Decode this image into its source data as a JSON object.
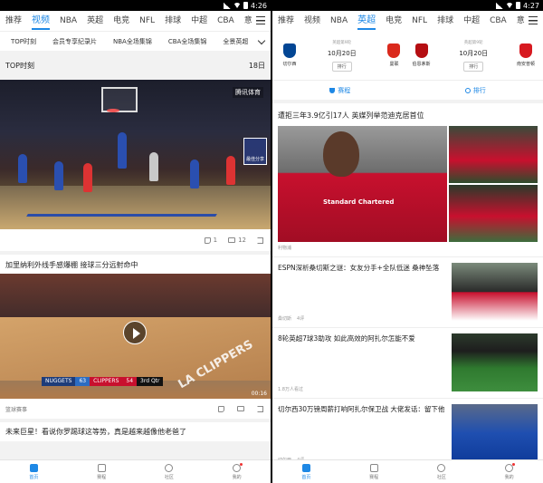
{
  "left": {
    "status": {
      "time": "4:26"
    },
    "tabs": [
      "推荐",
      "视频",
      "NBA",
      "英超",
      "电竞",
      "NFL",
      "排球",
      "中超",
      "CBA",
      "意"
    ],
    "active_tab": "视频",
    "chips": [
      "TOP时刻",
      "会员专享纪录片",
      "NBA全场集锦",
      "CBA全场集锦",
      "全景英超"
    ],
    "section": {
      "title": "TOP时刻",
      "date": "18日"
    },
    "video1": {
      "watermark": "腾讯体育",
      "mini_label": "最佳分享",
      "likes": "1",
      "comments": "12"
    },
    "video2": {
      "title": "加里纳利外线手感爆棚 接球三分远射命中",
      "court_logo": "LA CLIPPERS",
      "score": {
        "away": "NUGGETS",
        "away_score": "63",
        "home": "CLIPPERS",
        "home_score": "54",
        "period": "3rd Qtr"
      },
      "duration": "00:16",
      "source": "篮球赛事"
    },
    "video3": {
      "title": "未来巨星！看说你罗踢球这等势，真是越来越像他老爸了"
    }
  },
  "right": {
    "status": {
      "time": "4:27"
    },
    "tabs": [
      "推荐",
      "视频",
      "NBA",
      "英超",
      "电竞",
      "NFL",
      "排球",
      "中超",
      "CBA",
      "意"
    ],
    "active_tab": "英超",
    "matches": [
      {
        "home": "切尔西",
        "away": "曼联",
        "league": "英超第9轮",
        "date": "10月20日",
        "button": "排行",
        "home_color": "#034694",
        "away_color": "#da291c"
      },
      {
        "home": "伯恩茅斯",
        "away": "南安普顿",
        "league": "英超第9轮",
        "date": "10月20日",
        "button": "排行",
        "home_color": "#b50e12",
        "away_color": "#d71920"
      }
    ],
    "links": {
      "schedule": "赛程",
      "ranking": "排行"
    },
    "top_news": {
      "title": "遭拒三年3.9亿引17人 英媒列举范迪克居首位",
      "sponsor": "Standard Chartered",
      "source": "利物浦"
    },
    "news": [
      {
        "title": "ESPN深析桑切斯之谜：女友分手+全队低迷 桑神坠落",
        "source": "桑切斯",
        "count": "4评"
      },
      {
        "title": "8轮英超7球3助攻 如此高效的阿扎尔怎能不爱",
        "source": "1.8万人看过",
        "count": ""
      },
      {
        "title": "切尔西30万镑周薪打响阿扎尔保卫战 大佬发话：留下他",
        "source": "切尔西",
        "count": "4评"
      }
    ]
  },
  "nav": [
    "首页",
    "赛程",
    "社区",
    "我的"
  ]
}
